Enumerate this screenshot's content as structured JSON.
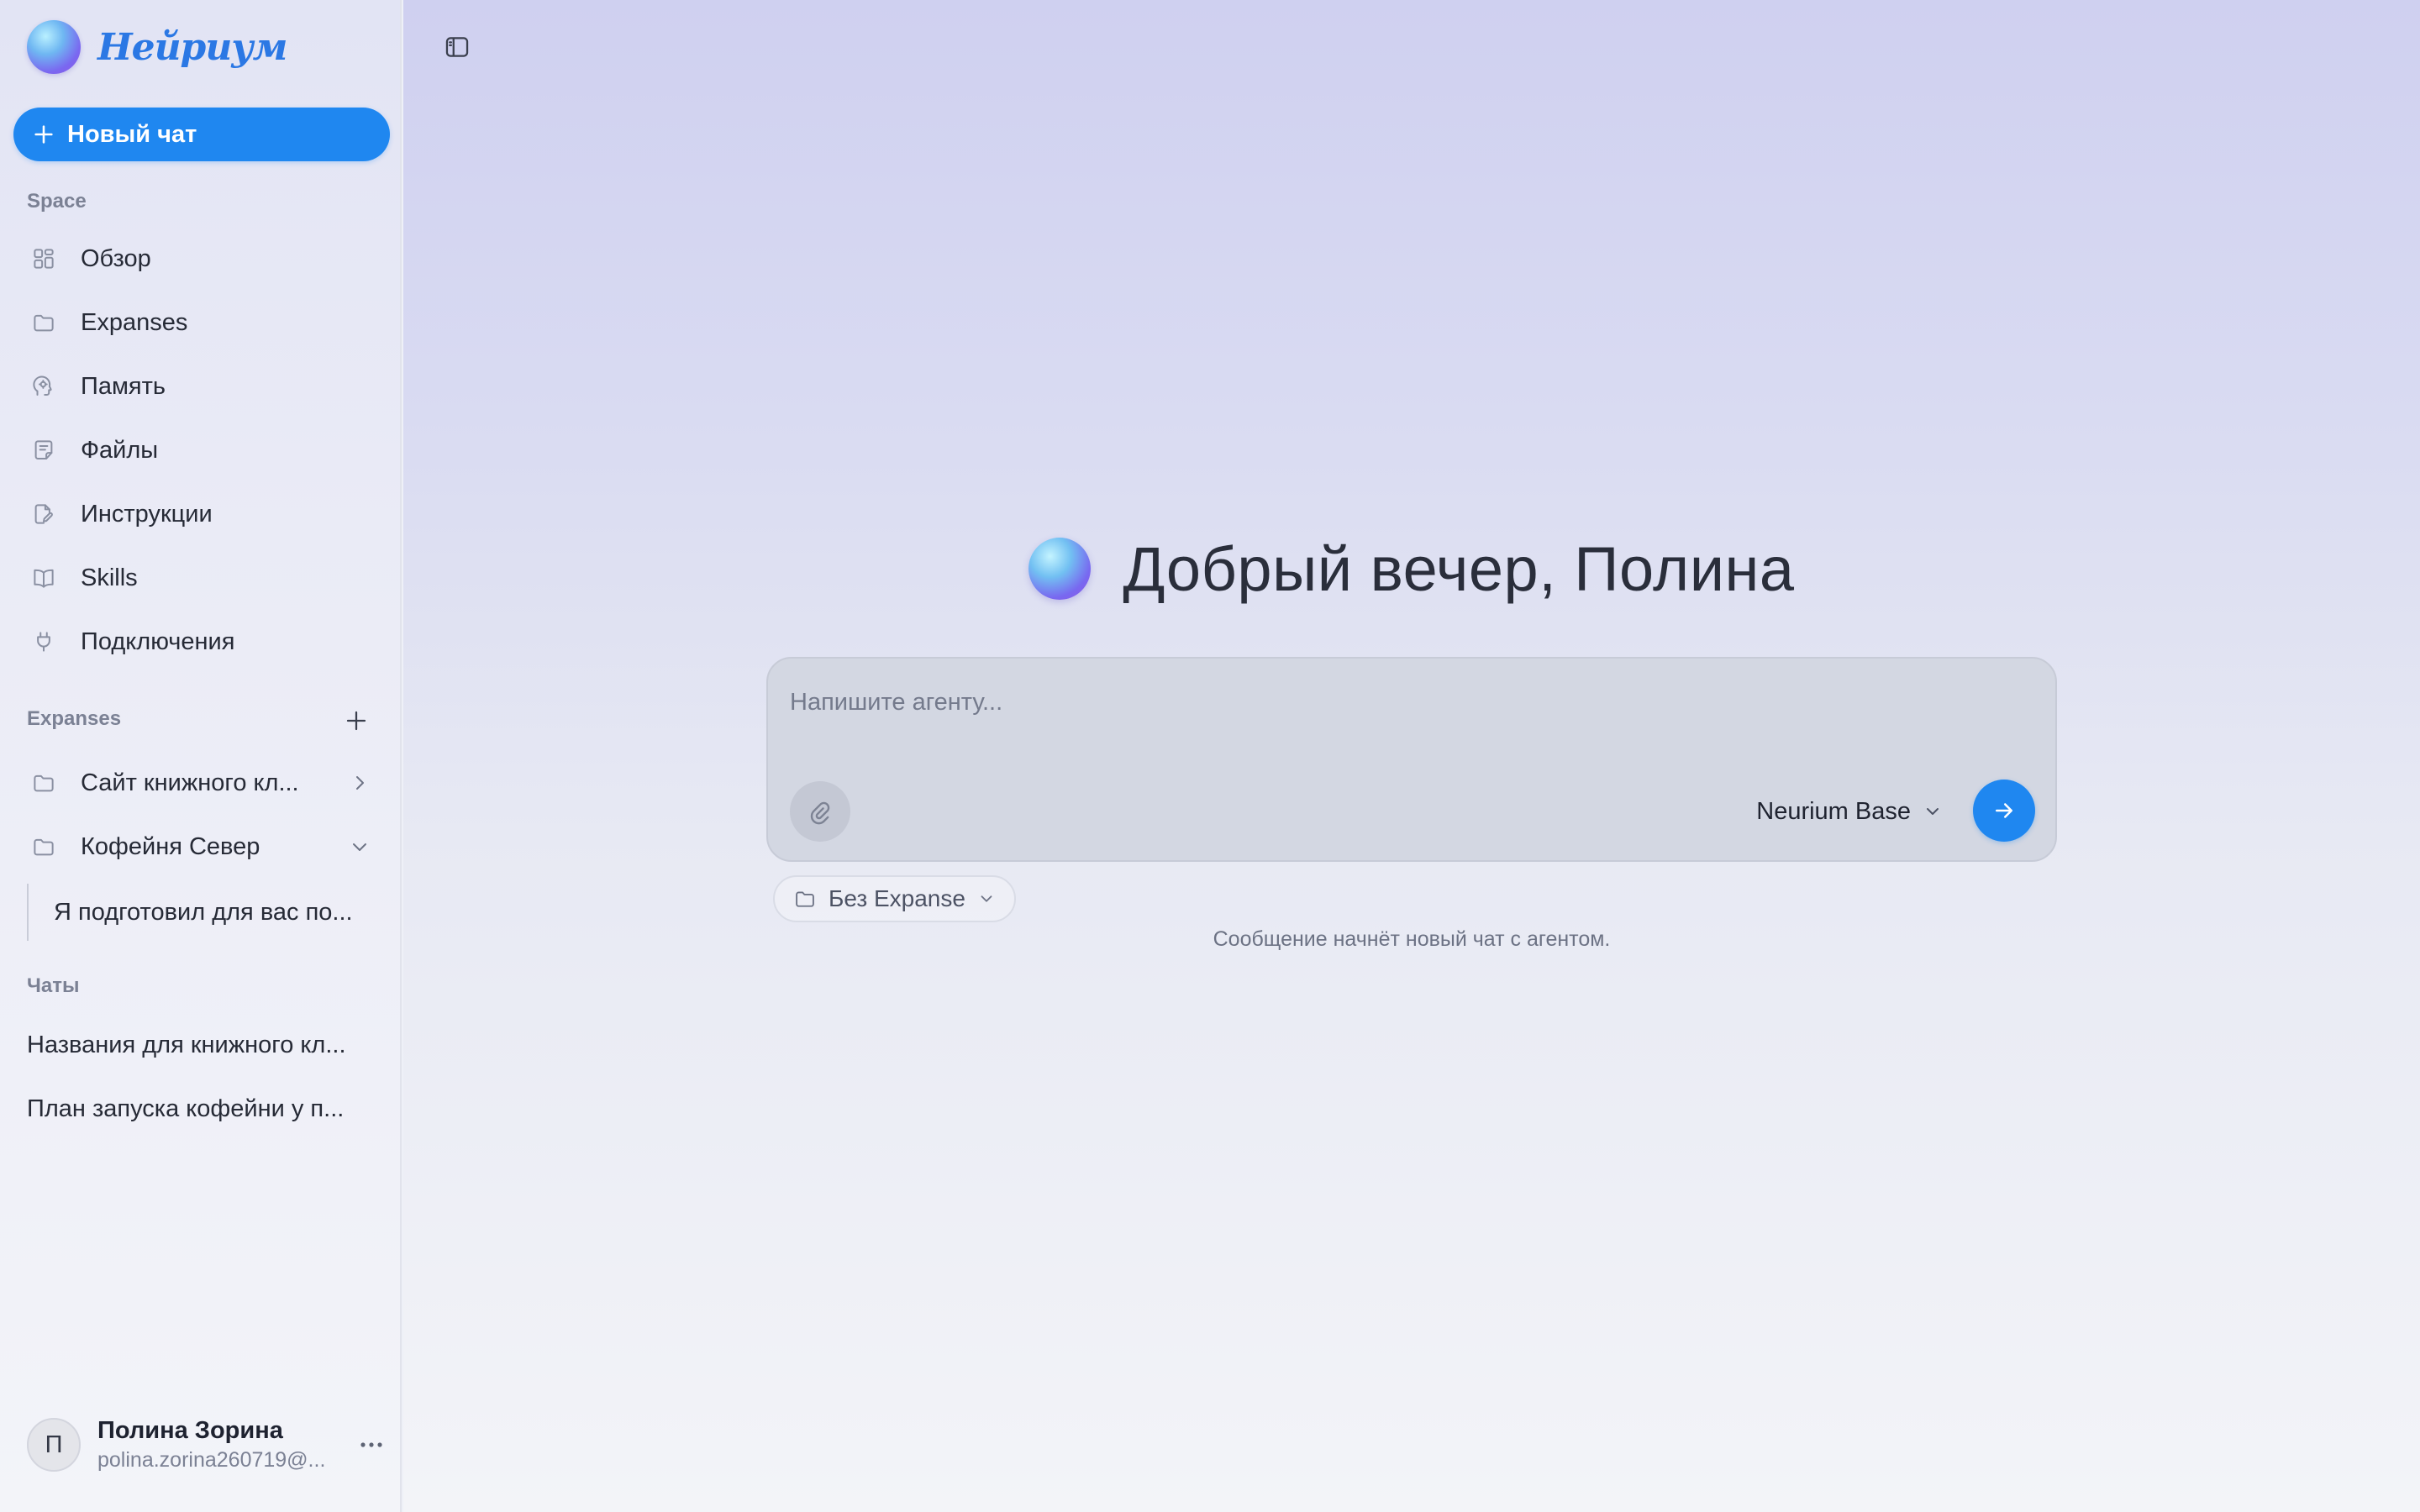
{
  "app": {
    "brand_name": "Нейриум",
    "brand_color": "#2b78e4",
    "accent_color": "#1f87f0"
  },
  "sidebar": {
    "new_chat_label": "Новый чат",
    "space_section_label": "Space",
    "nav_items": [
      {
        "label": "Обзор",
        "icon": "grid-icon"
      },
      {
        "label": "Expanses",
        "icon": "folder-icon"
      },
      {
        "label": "Память",
        "icon": "head-memory-icon"
      },
      {
        "label": "Файлы",
        "icon": "file-icon"
      },
      {
        "label": "Инструкции",
        "icon": "edit-document-icon"
      },
      {
        "label": "Skills",
        "icon": "book-icon"
      },
      {
        "label": "Подключения",
        "icon": "plug-icon"
      }
    ],
    "expanses_section_label": "Expanses",
    "expanses": [
      {
        "label": "Сайт книжного кл...",
        "icon": "folder-icon",
        "state": "collapsed"
      },
      {
        "label": "Кофейня Север",
        "icon": "folder-icon",
        "state": "expanded"
      }
    ],
    "expanse_thread": "Я подготовил для вас по...",
    "chats_section_label": "Чаты",
    "chats": [
      {
        "label": "Названия для книжного кл..."
      },
      {
        "label": "План запуска кофейни у п..."
      }
    ],
    "user": {
      "initial": "П",
      "name": "Полина Зорина",
      "email": "polina.zorina260719@..."
    }
  },
  "main": {
    "greeting": "Добрый вечер, Полина",
    "composer": {
      "placeholder": "Напишите агенту...",
      "value": "",
      "model_label": "Neurium Base"
    },
    "expanse_selector_label": "Без Expanse",
    "hint": "Сообщение начнёт новый чат с агентом."
  }
}
